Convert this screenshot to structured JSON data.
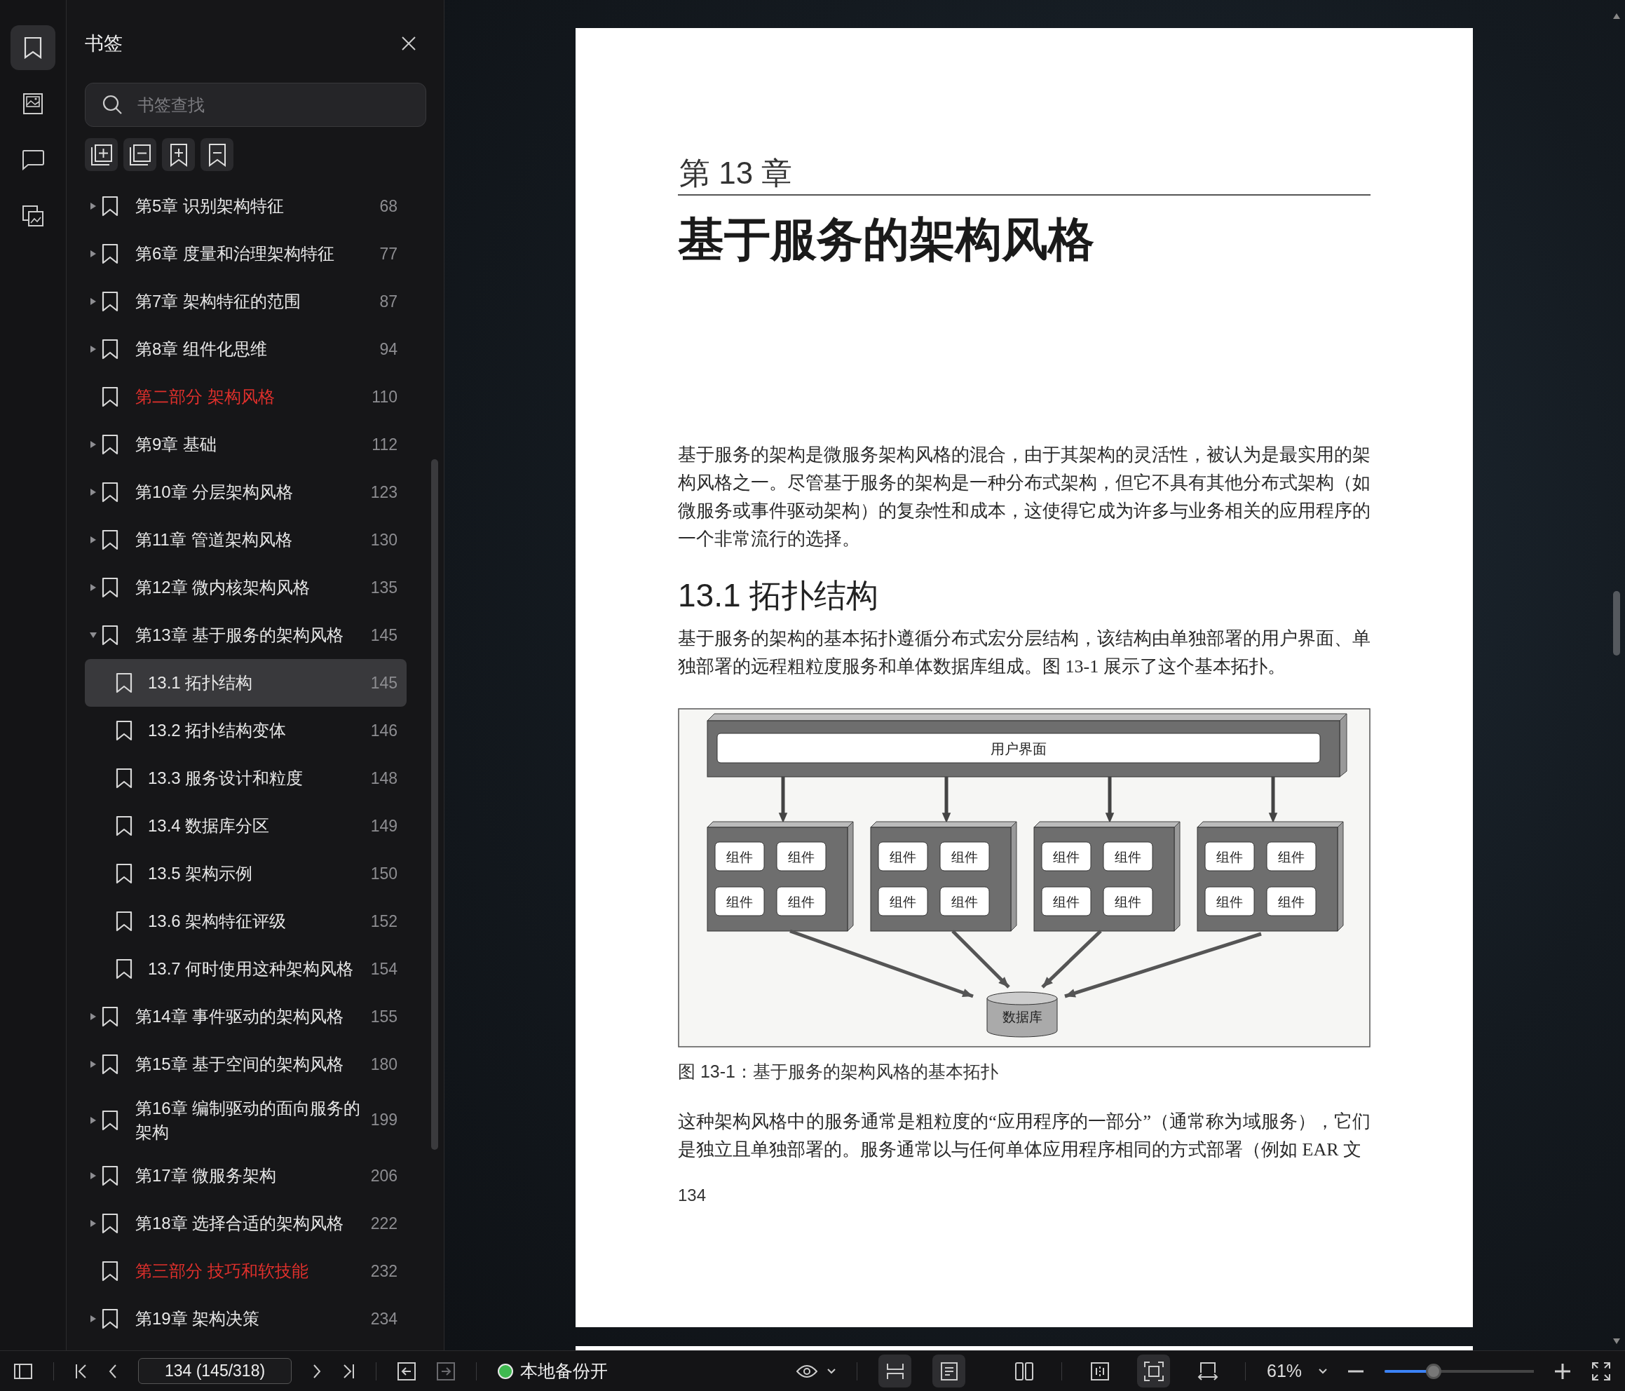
{
  "rail": [
    {
      "kind": "bookmarks",
      "selected": true
    },
    {
      "kind": "thumbnails",
      "selected": false
    },
    {
      "kind": "comments",
      "selected": false
    },
    {
      "kind": "attachments",
      "selected": false
    }
  ],
  "sidebar": {
    "title": "书签",
    "search": {
      "placeholder": "书签查找"
    },
    "tools": [
      {
        "kind": "expand-all"
      },
      {
        "kind": "collapse-all"
      },
      {
        "kind": "add-bookmark"
      },
      {
        "kind": "remove-bookmark"
      }
    ],
    "items": [
      {
        "kind": "chapter",
        "label": "第5章 识别架构特征",
        "page": "68",
        "expanded": false,
        "selected": false
      },
      {
        "kind": "chapter",
        "label": "第6章 度量和治理架构特征",
        "page": "77",
        "expanded": false,
        "selected": false
      },
      {
        "kind": "chapter",
        "label": "第7章 架构特征的范围",
        "page": "87",
        "expanded": false,
        "selected": false
      },
      {
        "kind": "chapter",
        "label": "第8章 组件化思维",
        "page": "94",
        "expanded": false,
        "selected": false
      },
      {
        "kind": "part",
        "label": "第二部分 架构风格",
        "page": "110",
        "selected": false
      },
      {
        "kind": "chapter",
        "label": "第9章 基础",
        "page": "112",
        "expanded": false,
        "selected": false
      },
      {
        "kind": "chapter",
        "label": "第10章 分层架构风格",
        "page": "123",
        "expanded": false,
        "selected": false
      },
      {
        "kind": "chapter",
        "label": "第11章 管道架构风格",
        "page": "130",
        "expanded": false,
        "selected": false
      },
      {
        "kind": "chapter",
        "label": "第12章 微内核架构风格",
        "page": "135",
        "expanded": false,
        "selected": false
      },
      {
        "kind": "chapter",
        "label": "第13章 基于服务的架构风格",
        "page": "145",
        "expanded": true,
        "selected": false,
        "children": [
          {
            "label": "13.1 拓扑结构",
            "page": "145",
            "selected": true
          },
          {
            "label": "13.2 拓扑结构变体",
            "page": "146",
            "selected": false
          },
          {
            "label": "13.3 服务设计和粒度",
            "page": "148",
            "selected": false
          },
          {
            "label": "13.4 数据库分区",
            "page": "149",
            "selected": false
          },
          {
            "label": "13.5 架构示例",
            "page": "150",
            "selected": false
          },
          {
            "label": "13.6 架构特征评级",
            "page": "152",
            "selected": false
          },
          {
            "label": "13.7 何时使用这种架构风格",
            "page": "154",
            "selected": false
          }
        ]
      },
      {
        "kind": "chapter",
        "label": "第14章 事件驱动的架构风格",
        "page": "155",
        "expanded": false,
        "selected": false
      },
      {
        "kind": "chapter",
        "label": "第15章 基于空间的架构风格",
        "page": "180",
        "expanded": false,
        "selected": false
      },
      {
        "kind": "chapter",
        "label": "第16章 编制驱动的面向服务的架构",
        "page": "199",
        "expanded": false,
        "selected": false
      },
      {
        "kind": "chapter",
        "label": "第17章 微服务架构",
        "page": "206",
        "expanded": false,
        "selected": false
      },
      {
        "kind": "chapter",
        "label": "第18章 选择合适的架构风格",
        "page": "222",
        "expanded": false,
        "selected": false
      },
      {
        "kind": "part",
        "label": "第三部分 技巧和软技能",
        "page": "232",
        "selected": false
      },
      {
        "kind": "chapter",
        "label": "第19章 架构决策",
        "page": "234",
        "expanded": false,
        "selected": false
      }
    ]
  },
  "document": {
    "blocks": [
      {
        "kind": "chapter-label",
        "text": "第 13 章"
      },
      {
        "kind": "title",
        "text": "基于服务的架构风格"
      },
      {
        "kind": "paragraph",
        "text": "基于服务的架构是微服务架构风格的混合，由于其架构的灵活性，被认为是最实用的架构风格之一。尽管基于服务的架构是一种分布式架构，但它不具有其他分布式架构（如微服务或事件驱动架构）的复杂性和成本，这使得它成为许多与业务相关的应用程序的一个非常流行的选择。"
      },
      {
        "kind": "heading",
        "text": "13.1 拓扑结构"
      },
      {
        "kind": "paragraph",
        "text": "基于服务的架构的基本拓扑遵循分布式宏分层结构，该结构由单独部署的用户界面、单独部署的远程粗粒度服务和单体数据库组成。图 13-1 展示了这个基本拓扑。"
      },
      {
        "kind": "figure",
        "ui_label": "用户界面",
        "database_label": "数据库",
        "services": [
          {
            "components": [
              "组件",
              "组件",
              "组件",
              "组件"
            ]
          },
          {
            "components": [
              "组件",
              "组件",
              "组件",
              "组件"
            ]
          },
          {
            "components": [
              "组件",
              "组件",
              "组件",
              "组件"
            ]
          },
          {
            "components": [
              "组件",
              "组件",
              "组件",
              "组件"
            ]
          }
        ]
      },
      {
        "kind": "caption",
        "text": "图 13-1：基于服务的架构风格的基本拓扑"
      },
      {
        "kind": "paragraph",
        "text": "这种架构风格中的服务通常是粗粒度的“应用程序的一部分”（通常称为域服务），它们是独立且单独部署的。服务通常以与任何单体应用程序相同的方式部署（例如 EAR 文"
      },
      {
        "kind": "page-number",
        "text": "134"
      }
    ]
  },
  "toolbar": {
    "page_field": {
      "value": "134 (145/318)"
    },
    "back": {
      "disabled": false
    },
    "forward": {
      "disabled": true
    },
    "backup": {
      "on": true,
      "label": "本地备份开"
    },
    "view_modes": [
      {
        "kind": "continuous",
        "selected": true
      },
      {
        "kind": "single",
        "selected": true
      },
      {
        "kind": "two-page",
        "selected": false
      }
    ],
    "fit_modes": [
      {
        "kind": "split",
        "selected": false
      },
      {
        "kind": "fit-page",
        "selected": true
      },
      {
        "kind": "fit-width",
        "selected": false
      }
    ],
    "zoom": {
      "value": "61%",
      "level": 0.33
    }
  }
}
